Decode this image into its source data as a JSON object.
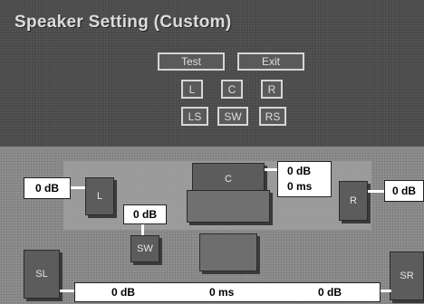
{
  "title": "Speaker Setting (Custom)",
  "buttons": {
    "test": "Test",
    "exit": "Exit",
    "l": "L",
    "c": "C",
    "r": "R",
    "ls": "LS",
    "sw": "SW",
    "rs": "RS"
  },
  "speakers": {
    "left": "L",
    "center": "C",
    "right": "R",
    "subwoofer": "SW",
    "surround_left": "SL",
    "surround_right": "SR"
  },
  "levels": {
    "left_db": "0 dB",
    "right_db": "0 dB",
    "subwoofer_db": "0 dB",
    "center_db": "0 dB",
    "center_ms": "0 ms",
    "surround_left_db": "0 dB",
    "surround_ms": "0 ms",
    "surround_right_db": "0 dB"
  }
}
